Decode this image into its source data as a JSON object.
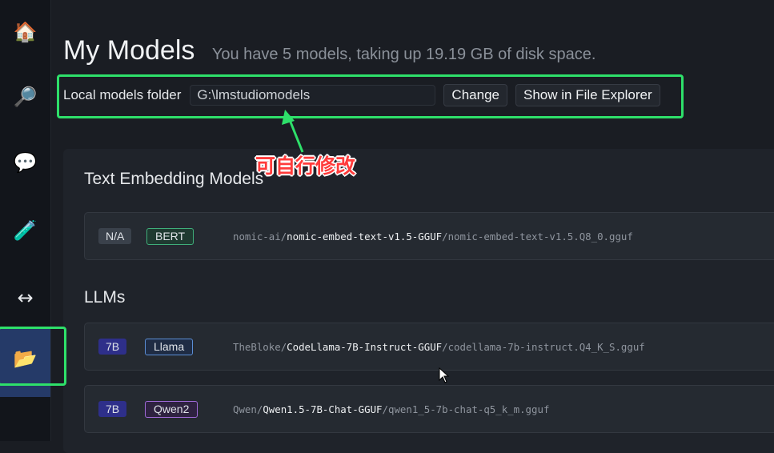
{
  "sidebar": {
    "items": [
      {
        "name": "home",
        "icon": "house-icon",
        "glyph": "🏠"
      },
      {
        "name": "search",
        "icon": "magnifier-icon",
        "glyph": "🔎"
      },
      {
        "name": "chat",
        "icon": "chat-bubble-icon",
        "glyph": "💬"
      },
      {
        "name": "lab",
        "icon": "test-tube-icon",
        "glyph": "🧪"
      },
      {
        "name": "server",
        "icon": "left-right-arrow-icon",
        "glyph": "↔"
      },
      {
        "name": "my-models",
        "icon": "open-folder-icon",
        "glyph": "📂",
        "active": true
      }
    ]
  },
  "header": {
    "title": "My Models",
    "subtitle": "You have 5 models, taking up 19.19 GB of disk space."
  },
  "folder": {
    "label": "Local models folder",
    "value": "G:\\lmstudiomodels",
    "change_label": "Change",
    "explorer_label": "Show in File Explorer"
  },
  "annotation": {
    "text": "可自行修改",
    "color": "#ff3b3b",
    "highlight_color": "#2ee06a"
  },
  "sections": [
    {
      "title": "Text Embedding Models",
      "models": [
        {
          "size": "N/A",
          "arch": "BERT",
          "publisher": "nomic-ai",
          "repo": "nomic-embed-text-v1.5-GGUF",
          "file": "nomic-embed-text-v1.5.Q8_0.gguf"
        }
      ]
    },
    {
      "title": "LLMs",
      "models": [
        {
          "size": "7B",
          "arch": "Llama",
          "publisher": "TheBloke",
          "repo": "CodeLlama-7B-Instruct-GGUF",
          "file": "codellama-7b-instruct.Q4_K_S.gguf"
        },
        {
          "size": "7B",
          "arch": "Qwen2",
          "publisher": "Qwen",
          "repo": "Qwen1.5-7B-Chat-GGUF",
          "file": "qwen1_5-7b-chat-q5_k_m.gguf"
        }
      ]
    }
  ],
  "colors": {
    "sidebar_active": "#253a68",
    "bert_badge": "#3fae7a",
    "llama_badge": "#5b8ed6",
    "qwen_badge": "#a06ad8",
    "size_badge_7b": "#2e2f8a",
    "size_badge_na": "#3a414b"
  }
}
